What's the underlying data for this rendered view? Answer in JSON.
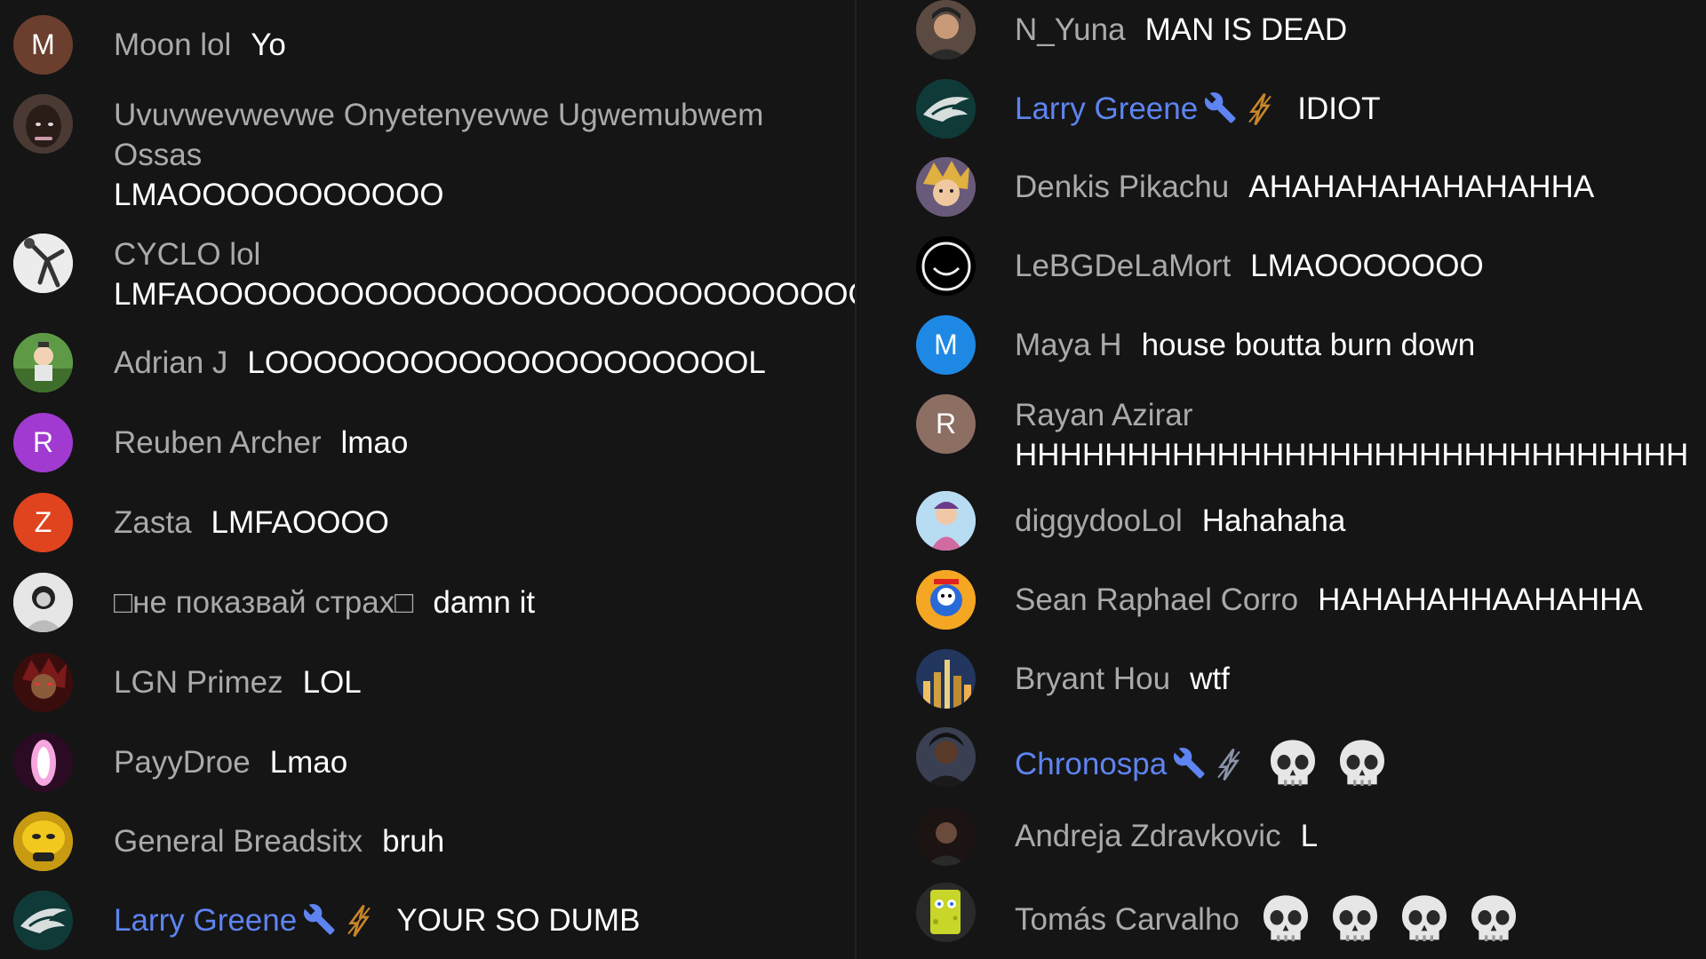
{
  "colors": {
    "background": "#151515",
    "author": "#aaaaaa",
    "moderator": "#5e84f1",
    "text": "#ffffff"
  },
  "left_messages": [
    {
      "author": "Moon lol",
      "text": "Yo",
      "avatar_letter": "M",
      "avatar_color": "#6b3e2e"
    },
    {
      "author": "Uvuvwevwevwe Onyetenyevwe Ugwemubwem",
      "author_line2": "Ossas",
      "text": "LMAOOOOOOOOOOO",
      "avatar_icon": "photo-face-icon"
    },
    {
      "author": "CYCLO lol",
      "text": "LMFAOOOOOOOOOOOOOOOOOOOOOOOOOOOOO",
      "avatar_icon": "photo-dancer-icon"
    },
    {
      "author": "Adrian J",
      "text": "LOOOOOOOOOOOOOOOOOOOOL",
      "avatar_icon": "photo-cartoon-icon"
    },
    {
      "author": "Reuben Archer",
      "text": "lmao",
      "avatar_letter": "R",
      "avatar_color": "#a13ad1"
    },
    {
      "author": "Zasta",
      "text": "LMFAOOOO",
      "avatar_letter": "Z",
      "avatar_color": "#e0441f"
    },
    {
      "author": "□не показвай страх□",
      "text": "damn it",
      "avatar_icon": "photo-portrait-icon"
    },
    {
      "author": "LGN Primez",
      "text": "LOL",
      "avatar_icon": "photo-anime-icon"
    },
    {
      "author": "PayyDroe",
      "text": "Lmao",
      "avatar_icon": "photo-glow-icon"
    },
    {
      "author": "General Breadsitx",
      "text": "bruh",
      "avatar_icon": "photo-yellow-icon"
    },
    {
      "author": "Larry Greene",
      "text": "YOUR SO DUMB",
      "moderator": true,
      "avatar_icon": "eagle-logo-icon"
    }
  ],
  "right_messages": [
    {
      "author": "N_Yuna",
      "text": "MAN IS DEAD",
      "avatar_icon": "photo-person-icon"
    },
    {
      "author": "Larry Greene",
      "text": "IDIOT",
      "moderator": true,
      "avatar_icon": "eagle-logo-icon"
    },
    {
      "author": "Denkis Pikachu",
      "text": "AHAHAHAHAHAHAHHA",
      "avatar_icon": "photo-anime-icon"
    },
    {
      "author": "LeBGDeLaMort",
      "text": "LMAOOOOOOO",
      "avatar_icon": "smiley-icon"
    },
    {
      "author": "Maya H",
      "text": "house boutta burn down",
      "avatar_letter": "M",
      "avatar_color": "#1e88e5"
    },
    {
      "author": "Rayan Azirar",
      "text": "HHHHHHHHHHHHHHHHHHHHHHHHHHHHHH",
      "avatar_letter": "R",
      "avatar_color": "#8d6e63"
    },
    {
      "author": "diggydooLol",
      "text": "Hahahaha",
      "avatar_icon": "photo-character-icon"
    },
    {
      "author": "Sean Raphael Corro",
      "text": "HAHAHAHHAAHAHHA",
      "avatar_icon": "photo-cartoon-icon"
    },
    {
      "author": "Bryant Hou",
      "text": "wtf",
      "avatar_icon": "photo-city-icon"
    },
    {
      "author": "Chronospa",
      "text": "",
      "moderator": true,
      "skulls": 2,
      "avatar_icon": "photo-person-icon"
    },
    {
      "author": "Andreja Zdravkovic",
      "text": "L",
      "avatar_icon": "photo-dark-icon"
    },
    {
      "author": "Tomás Carvalho",
      "text": "",
      "skulls": 4,
      "avatar_icon": "photo-sponge-icon"
    }
  ]
}
